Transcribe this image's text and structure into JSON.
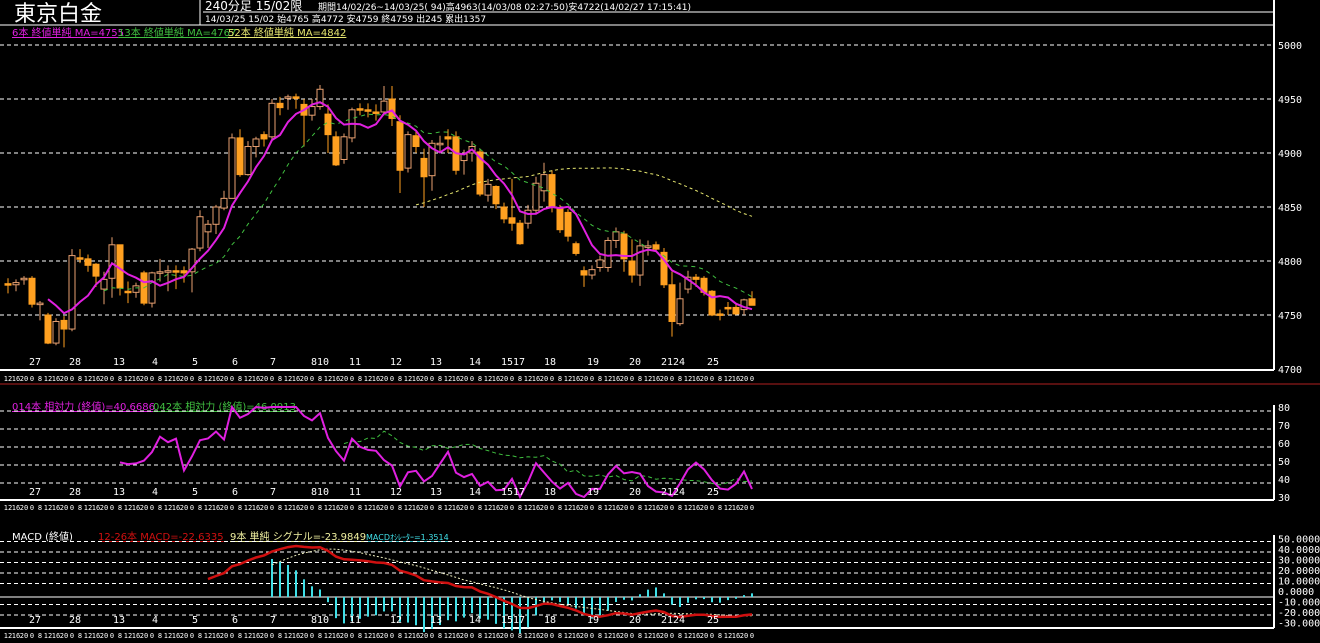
{
  "header": {
    "title": "東京白金",
    "timeframe": "240分足 15/02限",
    "period": "期間14/02/26~14/03/25( 94)高4963(14/03/08 02:27:50)安4722(14/02/27 17:15:41)",
    "last_bar": "14/03/25 15/02 始4765 高4772 安4759 終4759 出245 累出1357"
  },
  "legends": {
    "ma6": "6本 終値単純 MA=4755",
    "ma13": "13本 終値単純 MA=4767",
    "ma52": "52本 終値単純 MA=4842",
    "rsi14": "014本 相対力 (終値)=40.6686",
    "rsi42": "042本 相対力 (終値)=46.0913",
    "macd_title": "MACD (終値)",
    "macd": "12-26本 MACD=-22.6335",
    "signal": "9本 単純 シグナル=-23.9849",
    "osc": "MACDｵｼﾚｰﾀｰ=1.3514"
  },
  "colors": {
    "candle": "#ffa020",
    "candle_up_outline": "#e8a070",
    "ma6": "#e020e0",
    "ma13": "#40c040",
    "ma52": "#e8e870",
    "rsi14": "#e020e0",
    "rsi42": "#40c040",
    "macd": "#d01010",
    "signal": "#f0f0c0",
    "osc": "#40e0e8",
    "separator": "#b02020"
  },
  "chart_data": {
    "type": "candlestick",
    "title": "東京白金 240分足 15/02限",
    "candle_format": [
      "open",
      "high",
      "low",
      "close"
    ],
    "candles": [
      [
        4779,
        4784,
        4770,
        4779
      ],
      [
        4778,
        4783,
        4772,
        4780
      ],
      [
        4783,
        4786,
        4778,
        4784
      ],
      [
        4784,
        4786,
        4757,
        4760
      ],
      [
        4760,
        4763,
        4745,
        4761
      ],
      [
        4750,
        4752,
        4723,
        4724
      ],
      [
        4724,
        4747,
        4722,
        4744
      ],
      [
        4745,
        4749,
        4720,
        4737
      ],
      [
        4737,
        4811,
        4735,
        4805
      ],
      [
        4803,
        4811,
        4798,
        4802
      ],
      [
        4802,
        4806,
        4790,
        4796
      ],
      [
        4797,
        4798,
        4776,
        4786
      ],
      [
        4774,
        4790,
        4760,
        4783
      ],
      [
        4784,
        4822,
        4766,
        4815
      ],
      [
        4815,
        4815,
        4768,
        4775
      ],
      [
        4772,
        4781,
        4761,
        4771
      ],
      [
        4771,
        4780,
        4766,
        4777
      ],
      [
        4789,
        4791,
        4759,
        4761
      ],
      [
        4761,
        4790,
        4757,
        4789
      ],
      [
        4789,
        4802,
        4781,
        4790
      ],
      [
        4790,
        4796,
        4772,
        4791
      ],
      [
        4791,
        4796,
        4774,
        4791
      ],
      [
        4791,
        4795,
        4780,
        4789
      ],
      [
        4790,
        4812,
        4771,
        4811
      ],
      [
        4812,
        4847,
        4809,
        4841
      ],
      [
        4827,
        4838,
        4812,
        4834
      ],
      [
        4834,
        4852,
        4825,
        4850
      ],
      [
        4849,
        4865,
        4847,
        4858
      ],
      [
        4858,
        4918,
        4858,
        4914
      ],
      [
        4914,
        4922,
        4878,
        4880
      ],
      [
        4880,
        4911,
        4879,
        4906
      ],
      [
        4906,
        4915,
        4896,
        4913
      ],
      [
        4917,
        4920,
        4906,
        4913
      ],
      [
        4915,
        4950,
        4911,
        4946
      ],
      [
        4946,
        4952,
        4935,
        4942
      ],
      [
        4951,
        4954,
        4940,
        4952
      ],
      [
        4952,
        4955,
        4941,
        4951
      ],
      [
        4945,
        4950,
        4906,
        4935
      ],
      [
        4935,
        4950,
        4930,
        4943
      ],
      [
        4943,
        4963,
        4940,
        4959
      ],
      [
        4936,
        4945,
        4900,
        4917
      ],
      [
        4915,
        4920,
        4888,
        4889
      ],
      [
        4894,
        4918,
        4890,
        4915
      ],
      [
        4914,
        4942,
        4910,
        4940
      ],
      [
        4941,
        4946,
        4935,
        4940
      ],
      [
        4940,
        4946,
        4933,
        4939
      ],
      [
        4938,
        4945,
        4930,
        4937
      ],
      [
        4938,
        4962,
        4935,
        4948
      ],
      [
        4950,
        4962,
        4925,
        4932
      ],
      [
        4929,
        4935,
        4863,
        4884
      ],
      [
        4886,
        4920,
        4882,
        4917
      ],
      [
        4916,
        4920,
        4900,
        4906
      ],
      [
        4895,
        4904,
        4850,
        4878
      ],
      [
        4879,
        4912,
        4865,
        4909
      ],
      [
        4908,
        4916,
        4901,
        4909
      ],
      [
        4915,
        4922,
        4900,
        4913
      ],
      [
        4915,
        4920,
        4880,
        4884
      ],
      [
        4893,
        4903,
        4880,
        4899
      ],
      [
        4900,
        4911,
        4892,
        4906
      ],
      [
        4901,
        4904,
        4860,
        4862
      ],
      [
        4861,
        4876,
        4855,
        4871
      ],
      [
        4869,
        4870,
        4848,
        4853
      ],
      [
        4850,
        4854,
        4835,
        4839
      ],
      [
        4840,
        4876,
        4828,
        4835
      ],
      [
        4835,
        4838,
        4815,
        4816
      ],
      [
        4835,
        4852,
        4830,
        4847
      ],
      [
        4847,
        4878,
        4843,
        4872
      ],
      [
        4865,
        4891,
        4855,
        4880
      ],
      [
        4880,
        4884,
        4845,
        4850
      ],
      [
        4849,
        4852,
        4826,
        4829
      ],
      [
        4845,
        4848,
        4818,
        4823
      ],
      [
        4816,
        4818,
        4805,
        4807
      ],
      [
        4791,
        4795,
        4776,
        4787
      ],
      [
        4787,
        4796,
        4783,
        4792
      ],
      [
        4794,
        4805,
        4790,
        4801
      ],
      [
        4794,
        4822,
        4790,
        4819
      ],
      [
        4819,
        4831,
        4812,
        4827
      ],
      [
        4825,
        4828,
        4790,
        4802
      ],
      [
        4800,
        4820,
        4780,
        4787
      ],
      [
        4787,
        4820,
        4777,
        4814
      ],
      [
        4813,
        4819,
        4805,
        4814
      ],
      [
        4815,
        4818,
        4809,
        4811
      ],
      [
        4808,
        4812,
        4775,
        4778
      ],
      [
        4778,
        4790,
        4730,
        4744
      ],
      [
        4742,
        4780,
        4740,
        4765
      ],
      [
        4774,
        4791,
        4770,
        4785
      ],
      [
        4785,
        4788,
        4776,
        4783
      ],
      [
        4784,
        4786,
        4768,
        4771
      ],
      [
        4772,
        4773,
        4749,
        4750
      ],
      [
        4751,
        4755,
        4745,
        4751
      ],
      [
        4757,
        4762,
        4750,
        4757
      ],
      [
        4757,
        4760,
        4750,
        4751
      ],
      [
        4755,
        4765,
        4750,
        4764
      ],
      [
        4765,
        4772,
        4759,
        4759
      ]
    ],
    "ma_periods": [
      6,
      13,
      52
    ],
    "rsi_periods": [
      14,
      42
    ],
    "macd_params": [
      12,
      26,
      9
    ],
    "price_axis": {
      "range": [
        4700,
        5000
      ],
      "ticks": [
        "5000",
        "4950",
        "4900",
        "4850",
        "4800",
        "4750",
        "4700"
      ]
    },
    "rsi_axis": {
      "range": [
        30,
        80
      ],
      "ticks": [
        "80",
        "70",
        "60",
        "50",
        "40",
        "30"
      ]
    },
    "macd_axis": {
      "range": [
        -30,
        50
      ],
      "ticks": [
        "50.0000",
        "40.0000",
        "30.0000",
        "20.0000",
        "10.0000",
        "0.0000",
        "-10.0000",
        "-20.0000",
        "-30.0000"
      ]
    },
    "date_labels": [
      "27",
      "28",
      "13",
      "4",
      "5",
      "6",
      "7",
      "810",
      "11",
      "12",
      "13",
      "14",
      "1517",
      "18",
      "19",
      "20",
      "2124",
      "25"
    ],
    "time_cycle": [
      "12",
      "16",
      "20",
      "0",
      "8"
    ],
    "grid": true
  }
}
